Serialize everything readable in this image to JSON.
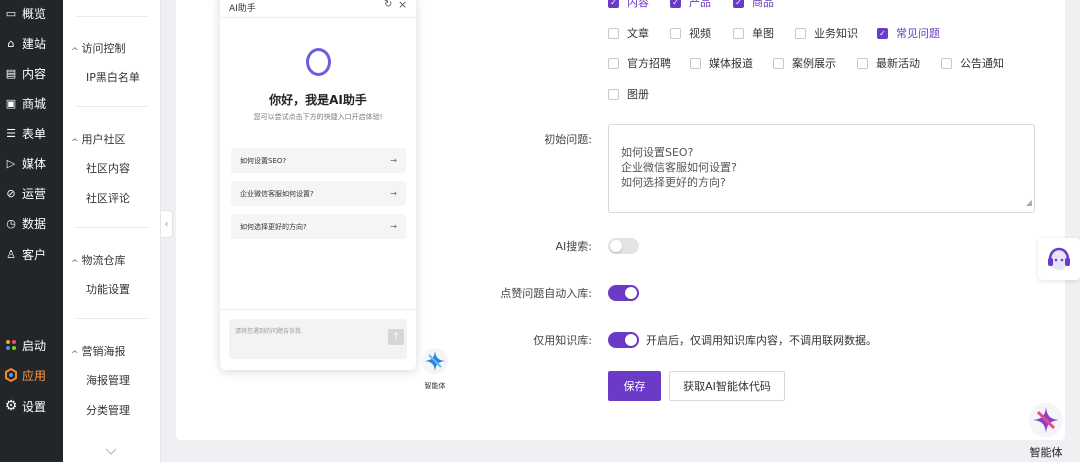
{
  "nav": {
    "items": [
      {
        "label": "概览",
        "icon": "monitor-icon"
      },
      {
        "label": "建站",
        "icon": "home-icon"
      },
      {
        "label": "内容",
        "icon": "document-icon"
      },
      {
        "label": "商城",
        "icon": "store-icon"
      },
      {
        "label": "表单",
        "icon": "form-icon"
      },
      {
        "label": "媒体",
        "icon": "video-icon"
      },
      {
        "label": "运营",
        "icon": "link-icon"
      },
      {
        "label": "数据",
        "icon": "clock-icon"
      },
      {
        "label": "客户",
        "icon": "user-icon"
      }
    ],
    "bottom": [
      {
        "label": "启动",
        "icon": "launch-icon"
      },
      {
        "label": "应用",
        "icon": "apps-icon"
      },
      {
        "label": "设置",
        "icon": "gear-icon"
      }
    ]
  },
  "subnav": {
    "groups": [
      {
        "title": "访问控制",
        "items": [
          "IP黑白名单"
        ]
      },
      {
        "title": "用户社区",
        "items": [
          "社区内容",
          "社区评论"
        ]
      },
      {
        "title": "物流仓库",
        "items": [
          "功能设置"
        ]
      },
      {
        "title": "营销海报",
        "items": [
          "海报管理",
          "分类管理"
        ]
      }
    ]
  },
  "form": {
    "top_clipped": [
      "内容",
      "产品",
      "商品"
    ],
    "categories": [
      {
        "label": "文章",
        "checked": false
      },
      {
        "label": "视频",
        "checked": false
      },
      {
        "label": "单图",
        "checked": false
      },
      {
        "label": "业务知识",
        "checked": false
      },
      {
        "label": "常见问题",
        "checked": true
      },
      {
        "label": "官方招聘",
        "checked": false
      },
      {
        "label": "媒体报道",
        "checked": false
      },
      {
        "label": "案例展示",
        "checked": false
      },
      {
        "label": "最新活动",
        "checked": false
      },
      {
        "label": "公告通知",
        "checked": false
      },
      {
        "label": "图册",
        "checked": false
      }
    ],
    "initial_questions_label": "初始问题:",
    "initial_questions_value": "如何设置SEO?\n企业微信客服如何设置?\n如何选择更好的方向?",
    "ai_search_label": "AI搜索:",
    "ai_search_on": false,
    "like_auto_label": "点赞问题自动入库:",
    "like_auto_on": true,
    "kb_only_label": "仅用知识库:",
    "kb_only_on": true,
    "kb_only_hint": "开启后，仅调用知识库内容，不调用联网数据。",
    "save_label": "保存",
    "get_code_label": "获取AI智能体代码"
  },
  "ai_panel": {
    "title": "AI助手",
    "greeting": "你好，我是AI助手",
    "subtitle": "您可以尝试点击下方的快捷入口开启体验!",
    "questions": [
      "如何设置SEO?",
      "企业微信客服如何设置?",
      "如何选择更好的方向?"
    ],
    "input_placeholder": "请将您遇到的问题告诉我"
  },
  "agent_label": "智能体",
  "colors": {
    "accent": "#6b3bc7",
    "nav_bg": "#232629",
    "active_nav": "#ff9a3c"
  }
}
